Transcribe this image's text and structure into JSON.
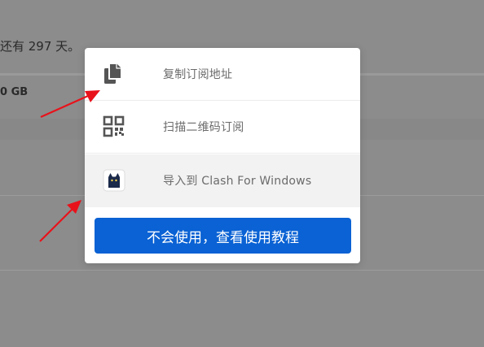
{
  "background": {
    "days_text": "还有 297 天。",
    "data_text": "0 GB"
  },
  "modal": {
    "items": [
      {
        "label": "复制订阅地址",
        "icon": "copy-icon"
      },
      {
        "label": "扫描二维码订阅",
        "icon": "qr-code-icon"
      },
      {
        "label": "导入到 Clash For Windows",
        "icon": "clash-cat-icon"
      }
    ],
    "help_button": "不会使用，查看使用教程"
  },
  "colors": {
    "overlay": "#8c8c8c",
    "primary_button": "#0a62d4",
    "arrow": "#e8121b",
    "highlight_row": "#f2f2f2"
  }
}
